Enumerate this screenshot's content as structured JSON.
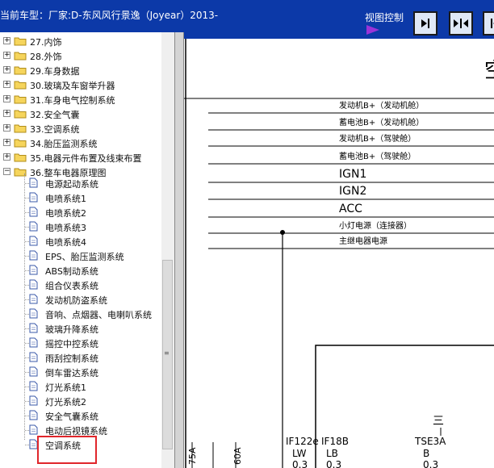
{
  "header": {
    "car_model": "当前车型：厂家:D-东风风行景逸（Joyear）2013-",
    "view_control": "视图控制"
  },
  "tree": {
    "items": [
      {
        "label": "27.内饰",
        "type": "folder"
      },
      {
        "label": "28.外饰",
        "type": "folder"
      },
      {
        "label": "29.车身数据",
        "type": "folder"
      },
      {
        "label": "30.玻璃及车窗举升器",
        "type": "folder"
      },
      {
        "label": "31.车身电气控制系统",
        "type": "folder"
      },
      {
        "label": "32.安全气囊",
        "type": "folder"
      },
      {
        "label": "33.空调系统",
        "type": "folder"
      },
      {
        "label": "34.胎压监测系统",
        "type": "folder"
      },
      {
        "label": "35.电器元件布置及线束布置",
        "type": "folder"
      },
      {
        "label": "36.整车电器原理图",
        "type": "folder-open"
      }
    ],
    "children": [
      "电源起动系统",
      "电喷系统1",
      "电喷系统2",
      "电喷系统3",
      "电喷系统4",
      "EPS、胎压监测系统",
      "ABS制动系统",
      "组合仪表系统",
      "发动机防盗系统",
      "音响、点烟器、电喇叭系统",
      "玻璃升降系统",
      "摇控中控系统",
      "雨刮控制系统",
      "倒车雷达系统",
      "灯光系统1",
      "灯光系统2",
      "安全气囊系统",
      "电动后视镜系统",
      "空调系统"
    ],
    "selected": "空调系统"
  },
  "diagram": {
    "title_char": "空",
    "rails": [
      "发动机B+（发动机舱）",
      "蓄电池B+（发动机舱）",
      "发动机B+（驾驶舱）",
      "蓄电池B+（驾驶舱）",
      "IGN1",
      "IGN2",
      "ACC",
      "小灯电源（连接器）",
      "主继电器电源"
    ],
    "fuses": [
      {
        "name": "IF122e",
        "value": "LW",
        "sub": "0.3"
      },
      {
        "name": "IF18B",
        "value": "LB",
        "sub": "0.3"
      },
      {
        "name": "TSE3A",
        "value": "B",
        "sub": "0.3"
      }
    ],
    "vertical_labels": [
      "75A",
      "60A"
    ],
    "ground_mark": "三"
  }
}
